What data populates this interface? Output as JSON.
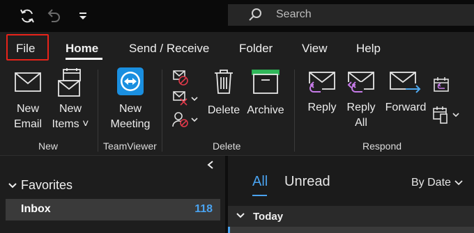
{
  "titlebar": {
    "sync_icon": "sync-icon",
    "undo_icon": "undo-icon",
    "customize_icon": "customize-toolbar-icon",
    "search_placeholder": "Search"
  },
  "tabs": [
    {
      "label": "File"
    },
    {
      "label": "Home"
    },
    {
      "label": "Send / Receive"
    },
    {
      "label": "Folder"
    },
    {
      "label": "View"
    },
    {
      "label": "Help"
    }
  ],
  "ribbon": {
    "new_email": {
      "line1": "New",
      "line2": "Email"
    },
    "new_items": {
      "line1": "New",
      "line2": "Items ˅"
    },
    "group_new": "New",
    "new_meeting": {
      "line1": "New",
      "line2": "Meeting"
    },
    "group_teamviewer": "TeamViewer",
    "delete": "Delete",
    "archive": "Archive",
    "group_delete": "Delete",
    "reply": "Reply",
    "reply_all": {
      "line1": "Reply",
      "line2": "All"
    },
    "forward": "Forward",
    "group_respond": "Respond"
  },
  "folders": {
    "favorites_label": "Favorites",
    "inbox_label": "Inbox",
    "inbox_count": "118"
  },
  "mail": {
    "filter_all": "All",
    "filter_unread": "Unread",
    "sort_label": "By Date",
    "group_today": "Today"
  },
  "colors": {
    "file_highlight": "#e8231a",
    "accent_blue": "#4aa3f0",
    "reply_purple": "#c67be8",
    "forward_blue": "#4fa9f0",
    "delete_red": "#e0394a",
    "archive_green": "#30b85a"
  }
}
